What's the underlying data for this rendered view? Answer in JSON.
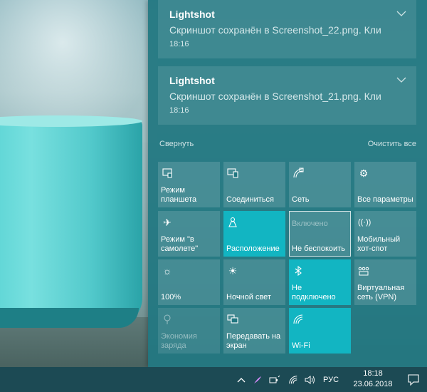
{
  "notifications": [
    {
      "app": "Lightshot",
      "message": "Скриншот сохранён в Screenshot_22.png. Кли",
      "time": "18:16"
    },
    {
      "app": "Lightshot",
      "message": "Скриншот сохранён в Screenshot_21.png. Кли",
      "time": "18:16"
    }
  ],
  "action_center": {
    "collapse_label": "Свернуть",
    "clear_all_label": "Очистить все"
  },
  "quick_actions": [
    {
      "label": "Режим\nпланшета",
      "icon": "tablet-mode-icon",
      "state": "off"
    },
    {
      "label": "Соединиться",
      "icon": "connect-icon",
      "state": "off"
    },
    {
      "label": "Сеть",
      "icon": "network-icon",
      "state": "off"
    },
    {
      "label": "Все параметры",
      "icon": "settings-gear-icon",
      "state": "off"
    },
    {
      "label": "Режим \"в\nсамолете\"",
      "icon": "airplane-icon",
      "state": "off"
    },
    {
      "label": "Расположение",
      "icon": "location-icon",
      "state": "on"
    },
    {
      "label": "Не беспокоить",
      "sublabel": "Включено",
      "icon": "do-not-disturb-icon",
      "state": "focused"
    },
    {
      "label": "Мобильный\nхот-спот",
      "icon": "mobile-hotspot-icon",
      "state": "off"
    },
    {
      "label": "100%",
      "icon": "brightness-icon",
      "state": "off"
    },
    {
      "label": "Ночной свет",
      "icon": "night-light-icon",
      "state": "off"
    },
    {
      "label": "Не\nподключено",
      "icon": "bluetooth-icon",
      "state": "on"
    },
    {
      "label": "Виртуальная\nсеть (VPN)",
      "icon": "vpn-icon",
      "state": "off"
    },
    {
      "label": "Экономия\nзаряда",
      "icon": "battery-saver-icon",
      "state": "disabled"
    },
    {
      "label": "Передавать на\nэкран",
      "icon": "project-icon",
      "state": "off"
    },
    {
      "label": "Wi-Fi",
      "icon": "wifi-icon",
      "state": "on"
    }
  ],
  "taskbar": {
    "language": "РУС",
    "time": "18:18",
    "date": "23.06.2018"
  },
  "colors": {
    "panel": "#207680",
    "tile_on": "#12b5c2",
    "taskbar": "#1c4a54"
  }
}
